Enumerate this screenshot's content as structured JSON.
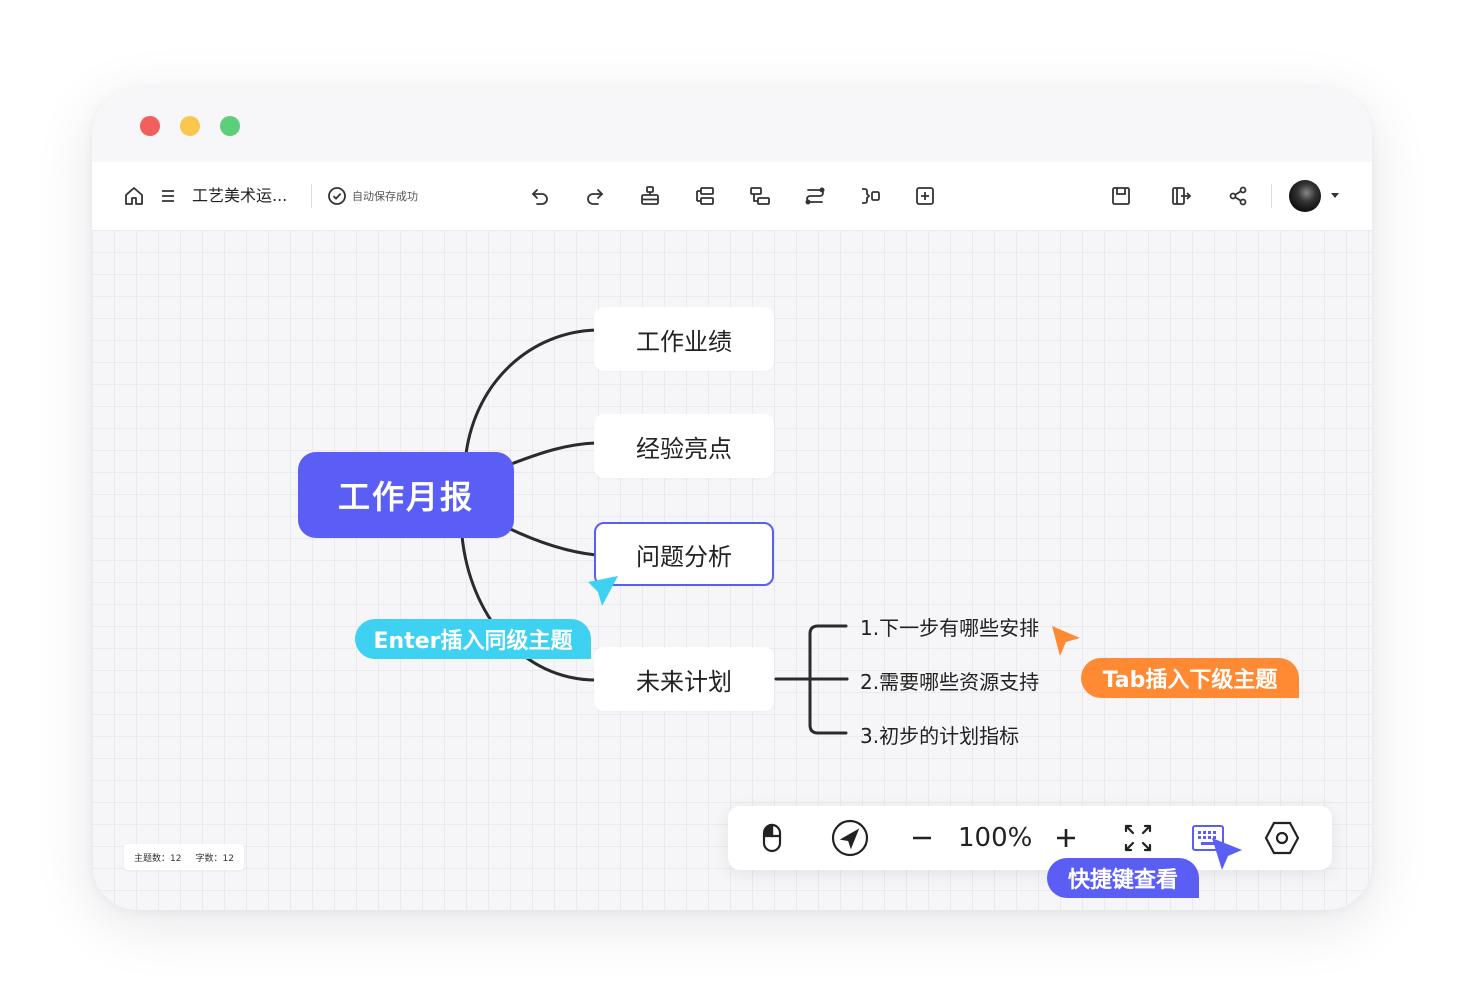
{
  "window": {
    "traffic_lights": [
      "#f25f5c",
      "#f9c74f",
      "#5bcf7a"
    ]
  },
  "toolbar": {
    "doc_title": "工艺美术运...",
    "save_status": "自动保存成功",
    "left_icons": [
      "home-icon",
      "menu-icon"
    ],
    "edit_icons": [
      "undo-icon",
      "redo-icon",
      "insert-parent-icon",
      "insert-sibling-icon",
      "insert-child-icon",
      "relation-line-icon",
      "summary-icon",
      "insert-topic-icon"
    ],
    "right_icons": [
      "save-icon",
      "export-icon",
      "share-icon",
      "avatar",
      "dropdown-icon"
    ]
  },
  "mindmap": {
    "root": "工作月报",
    "branches": [
      "工作业绩",
      "经验亮点",
      "问题分析",
      "未来计划"
    ],
    "selected_branch": "问题分析",
    "sub_topics": [
      "1.下一步有哪些安排",
      "2.需要哪些资源支持",
      "3.初步的计划指标"
    ]
  },
  "hints": {
    "enter": "Enter插入同级主题",
    "tab": "Tab插入下级主题",
    "shortcut": "快捷键查看"
  },
  "zoom_bar": {
    "zoom_level": "100%",
    "icons": [
      "mouse-mode-icon",
      "navigate-icon",
      "zoom-out-icon",
      "zoom-in-icon",
      "fullscreen-icon",
      "keyboard-icon",
      "settings-icon"
    ]
  },
  "stats": {
    "topics": "主题数：12",
    "words": "字数：12"
  },
  "colors": {
    "accent": "#5b5ef4",
    "enter_hint": "#3fd1f2",
    "tab_hint": "#ff8a33",
    "shortcut_hint": "#5b5ef4"
  }
}
